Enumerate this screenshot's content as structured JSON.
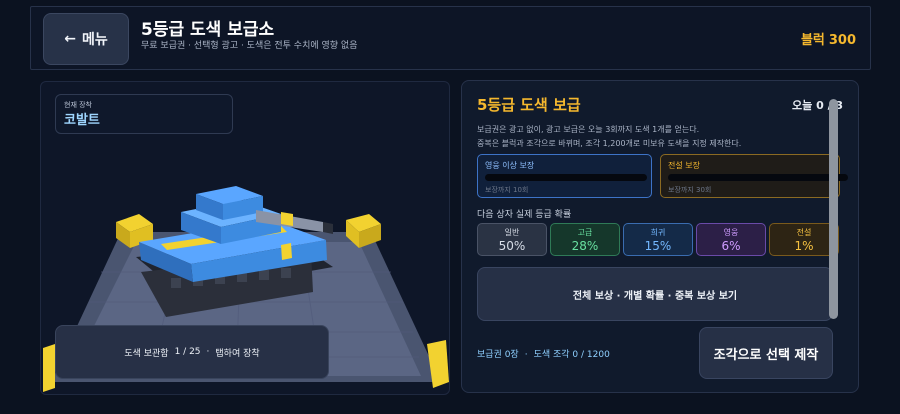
{
  "header": {
    "menu_label": "메뉴",
    "back_arrow": "←",
    "title": "5등급 도색 보급소",
    "subtitle": "무료 보급권 · 선택형 광고 · 도색은 전투 수치에 영향 없음",
    "currency_label": "블럭",
    "currency_value": "300"
  },
  "left_panel": {
    "equipped_label": "현재 장착",
    "equipped_value": "코발트",
    "collection_label": "도색 보관함",
    "collection_count": "1 / 25",
    "collection_sep": "·",
    "collection_hint": "탭하여 장착"
  },
  "supply": {
    "title": "5등급 도색 보급",
    "today_label": "오늘",
    "today_value": "0 / 3",
    "desc_line1": "보급권은 광고 없이, 광고 보급은 오늘 3회까지 도색 1개를 얻는다.",
    "desc_line2": "중복은 블럭과 조각으로 바뀌며, 조각 1,200개로 미보유 도색을 지정 제작한다.",
    "pity_hero": {
      "title": "영웅 이상 보장",
      "sub": "보장까지 10회",
      "progress": 0
    },
    "pity_legend": {
      "title": "전설 보장",
      "sub": "보장까지 30회",
      "progress": 0
    },
    "rates_title": "다음 상자 실제 등급 확률",
    "grades": [
      {
        "name": "일반",
        "rate": "50%"
      },
      {
        "name": "고급",
        "rate": "28%"
      },
      {
        "name": "희귀",
        "rate": "15%"
      },
      {
        "name": "영웅",
        "rate": "6%"
      },
      {
        "name": "전설",
        "rate": "1%"
      }
    ],
    "view_all_label": "전체 보상 · 개별 확률 · 중복 보상 보기",
    "tickets": "보급권 0장",
    "info_sep": "·",
    "shards": "도색 조각 0 / 1200",
    "craft_label": "조각으로 선택 제작"
  },
  "colors": {
    "accent": "#f5b82e",
    "hero": "#5aa0ff",
    "legend": "#f5b82e",
    "tank_blue": "#3d8be0",
    "tank_yellow": "#f2d230"
  }
}
